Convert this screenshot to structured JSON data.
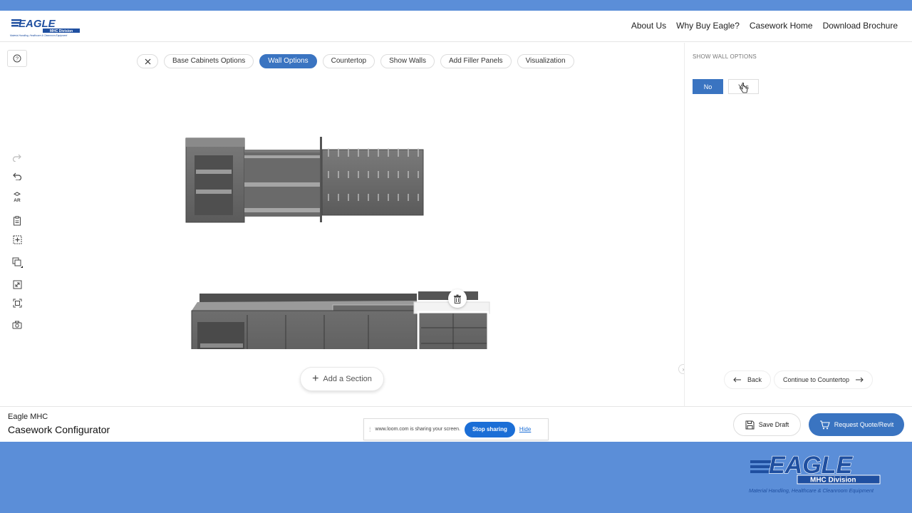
{
  "header": {
    "logo_text": "EAGLE",
    "logo_sub": "MHC Division",
    "logo_tagline": "Material Handling, Healthcare & Cleanroom Equipment",
    "nav": [
      "About Us",
      "Why Buy Eagle?",
      "Casework Home",
      "Download Brochure"
    ]
  },
  "tabs": {
    "close_icon": "close-icon",
    "items": [
      "Base Cabinets Options",
      "Wall Options",
      "Countertop",
      "Show Walls",
      "Add Filler Panels",
      "Visualization"
    ],
    "active": "Wall Options"
  },
  "toolbar": {
    "icons": [
      "help-icon",
      "redo-icon",
      "undo-icon",
      "ar-icon",
      "clipboard-icon",
      "add-box-icon",
      "copy-icon",
      "expand-icon",
      "fit-view-icon",
      "camera-icon"
    ],
    "ar_label": "AR"
  },
  "canvas": {
    "add_section": "Add a Section",
    "trash_icon": "trash-icon"
  },
  "panel": {
    "title": "SHOW WALL OPTIONS",
    "options": [
      "No",
      "Yes"
    ],
    "selected": "No",
    "back_label": "Back",
    "continue_label": "Continue to Countertop"
  },
  "footer": {
    "brand_sub": "Eagle MHC",
    "brand_main": "Casework Configurator",
    "share_text": "www.loom.com is sharing your screen.",
    "stop_label": "Stop sharing",
    "hide_label": "Hide",
    "save_draft": "Save Draft",
    "request_quote": "Request Quote/Revit"
  },
  "colors": {
    "accent": "#3a74c1",
    "band": "#5b8ed8",
    "loom_blue": "#1b6ed6"
  }
}
